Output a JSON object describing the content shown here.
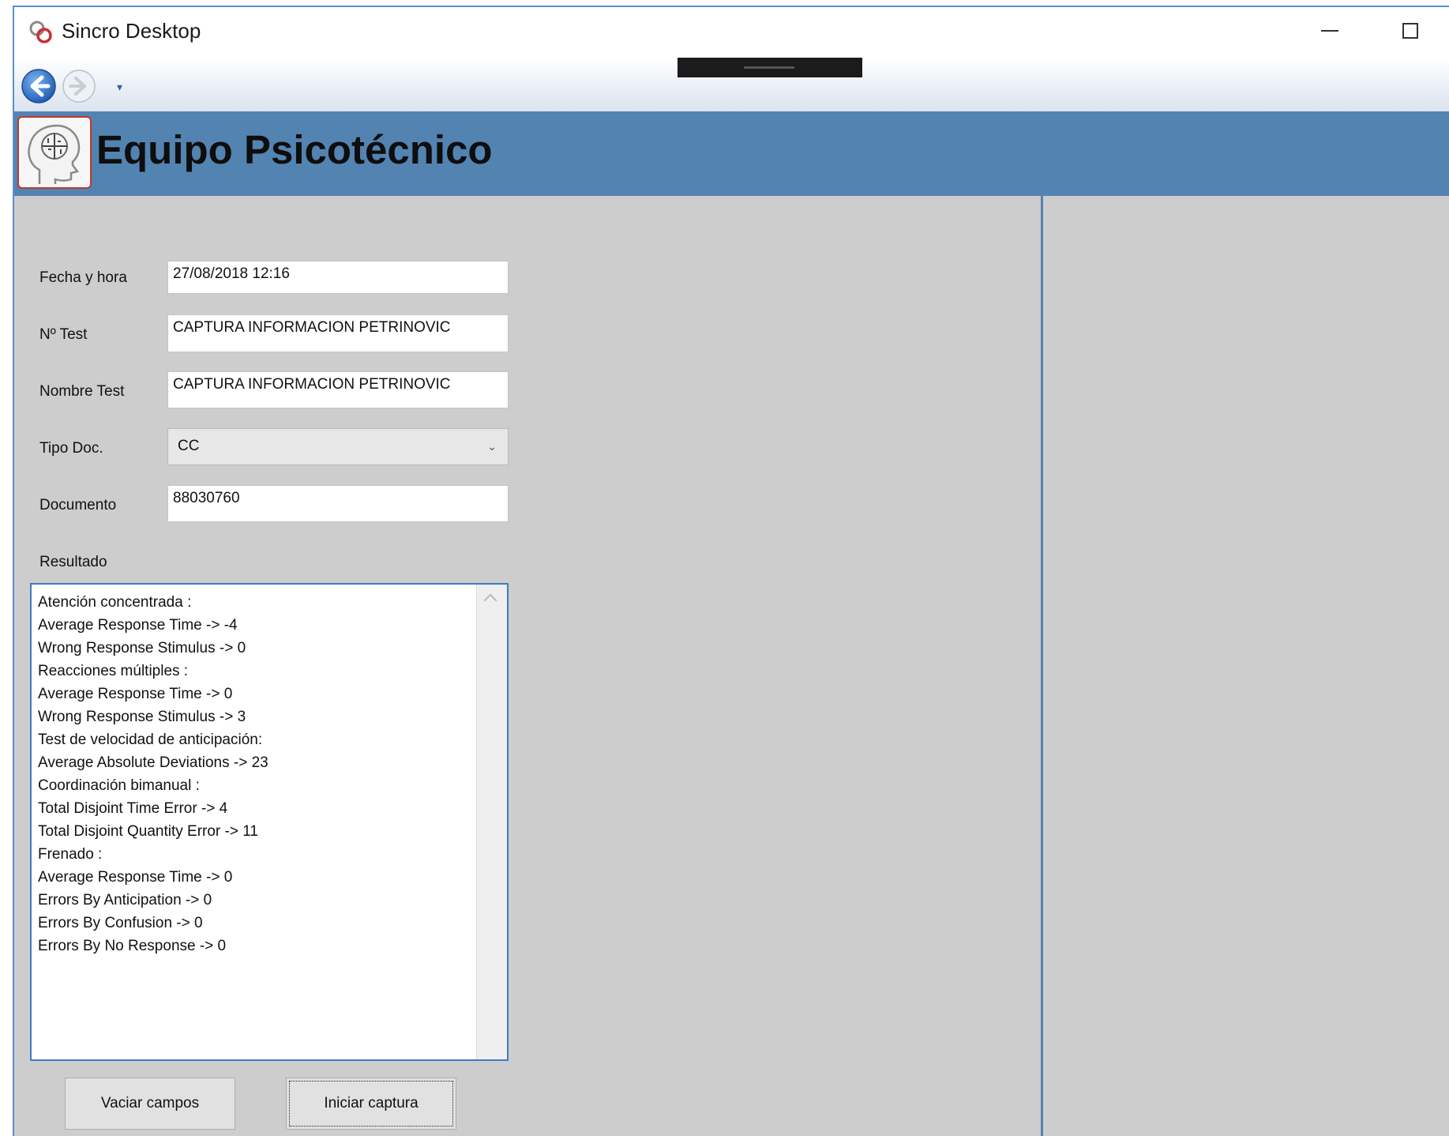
{
  "window": {
    "title": "Sincro Desktop",
    "minimize_symbol": "—",
    "maximize_symbol": "☐",
    "icons": [
      "app-logo-icon",
      "back-arrow-icon",
      "forward-arrow-icon",
      "chevron-down-icon",
      "head-brain-icon"
    ]
  },
  "nav": {
    "dropdown_symbol": "▾"
  },
  "header": {
    "title": "Equipo Psicotécnico",
    "bar_color": "#5383b1"
  },
  "form": {
    "fecha": {
      "label": "Fecha y hora",
      "value": "27/08/2018 12:16"
    },
    "num_test": {
      "label": "Nº Test",
      "value": "CAPTURA INFORMACION PETRINOVIC"
    },
    "nombre_test": {
      "label": "Nombre Test",
      "value": "CAPTURA INFORMACION PETRINOVIC"
    },
    "tipo_doc": {
      "label": "Tipo Doc.",
      "value": "CC",
      "arrow": "⌄"
    },
    "documento": {
      "label": "Documento",
      "value": "88030760"
    },
    "resultado": {
      "label": "Resultado",
      "lines": [
        "Atención concentrada :",
        "Average Response Time -> -4",
        "Wrong Response Stimulus -> 0",
        "Reacciones múltiples :",
        "Average Response Time -> 0",
        "Wrong Response Stimulus -> 3",
        "Test de velocidad de anticipación:",
        "Average Absolute Deviations -> 23",
        "Coordinación bimanual :",
        "Total Disjoint Time Error -> 4",
        "Total Disjoint Quantity Error -> 11",
        "Frenado :",
        "Average Response Time -> 0",
        "Errors By Anticipation -> 0",
        "Errors By Confusion -> 0",
        "Errors By No Response -> 0"
      ]
    }
  },
  "buttons": {
    "clear": "Vaciar campos",
    "start": "Iniciar captura"
  }
}
